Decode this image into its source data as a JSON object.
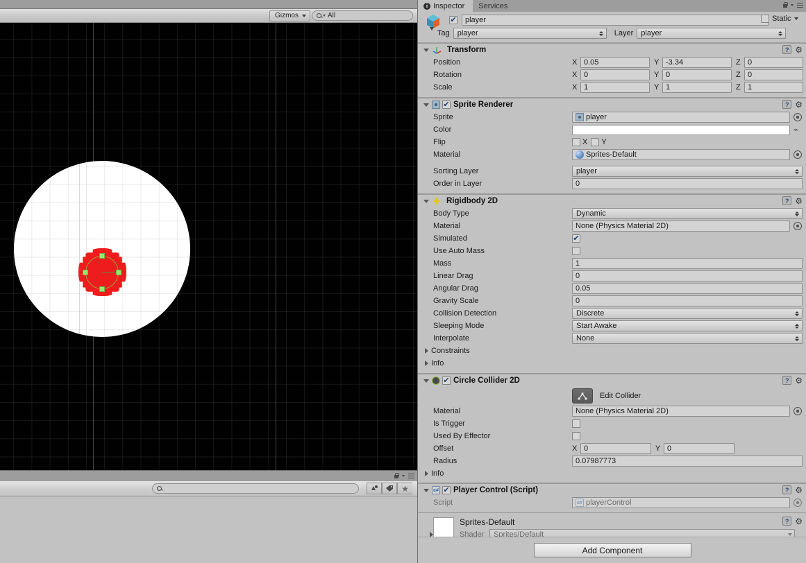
{
  "scene": {
    "toolbar": {
      "gizmos_label": "Gizmos",
      "search_value": "All"
    },
    "object": {
      "sprite_name": "player",
      "sprite_color": "#ee1c1c",
      "background": "#010101",
      "circle_color": "#ffffff"
    }
  },
  "project": {
    "search_placeholder": ""
  },
  "inspector": {
    "tabs": [
      {
        "label": "Inspector",
        "active": true,
        "icon": "info-icon"
      },
      {
        "label": "Services",
        "active": false
      }
    ],
    "gameobject": {
      "enabled": true,
      "name": "player",
      "static_label": "Static",
      "static_checked": false,
      "tag_label": "Tag",
      "tag_value": "player",
      "layer_label": "Layer",
      "layer_value": "player"
    },
    "components": [
      {
        "title": "Transform",
        "icon": "transform-axis-icon",
        "expanded": true,
        "has_enable_checkbox": false,
        "rows": [
          {
            "label": "Position",
            "type": "vector3",
            "x": "0.05",
            "y": "-3.34",
            "z": "0"
          },
          {
            "label": "Rotation",
            "type": "vector3",
            "x": "0",
            "y": "0",
            "z": "0"
          },
          {
            "label": "Scale",
            "type": "vector3",
            "x": "1",
            "y": "1",
            "z": "1"
          }
        ]
      },
      {
        "title": "Sprite Renderer",
        "icon": "sprite-renderer-icon",
        "expanded": true,
        "has_enable_checkbox": true,
        "enabled": true,
        "rows": [
          {
            "label": "Sprite",
            "type": "object",
            "value": "player",
            "icon": "sprite-asset-icon"
          },
          {
            "label": "Color",
            "type": "color",
            "value": "#ffffff"
          },
          {
            "label": "Flip",
            "type": "flip",
            "x_label": "X",
            "y_label": "Y",
            "x_checked": false,
            "y_checked": false
          },
          {
            "label": "Material",
            "type": "object",
            "value": "Sprites-Default",
            "icon": "material-sphere-icon"
          },
          {
            "label": "Sorting Layer",
            "type": "dropdown",
            "value": "player"
          },
          {
            "label": "Order in Layer",
            "type": "text",
            "value": "0"
          }
        ]
      },
      {
        "title": "Rigidbody 2D",
        "icon": "rigidbody2d-icon",
        "expanded": true,
        "has_enable_checkbox": false,
        "rows": [
          {
            "label": "Body Type",
            "type": "dropdown",
            "value": "Dynamic"
          },
          {
            "label": "Material",
            "type": "object",
            "value": "None (Physics Material 2D)"
          },
          {
            "label": "Simulated",
            "type": "checkbox",
            "checked": true
          },
          {
            "label": "Use Auto Mass",
            "type": "checkbox",
            "checked": false
          },
          {
            "label": "Mass",
            "type": "text",
            "value": "1"
          },
          {
            "label": "Linear Drag",
            "type": "text",
            "value": "0"
          },
          {
            "label": "Angular Drag",
            "type": "text",
            "value": "0.05"
          },
          {
            "label": "Gravity Scale",
            "type": "text",
            "value": "0"
          },
          {
            "label": "Collision Detection",
            "type": "dropdown",
            "value": "Discrete"
          },
          {
            "label": "Sleeping Mode",
            "type": "dropdown",
            "value": "Start Awake"
          },
          {
            "label": "Interpolate",
            "type": "dropdown",
            "value": "None"
          },
          {
            "label": "Constraints",
            "type": "foldout"
          },
          {
            "label": "Info",
            "type": "foldout"
          }
        ]
      },
      {
        "title": "Circle Collider 2D",
        "icon": "circle-collider-icon",
        "expanded": true,
        "has_enable_checkbox": true,
        "enabled": true,
        "edit_collider_label": "Edit Collider",
        "rows": [
          {
            "label": "Material",
            "type": "object",
            "value": "None (Physics Material 2D)"
          },
          {
            "label": "Is Trigger",
            "type": "checkbox",
            "checked": false
          },
          {
            "label": "Used By Effector",
            "type": "checkbox",
            "checked": false
          },
          {
            "label": "Offset",
            "type": "vector2",
            "x": "0",
            "y": "0"
          },
          {
            "label": "Radius",
            "type": "text",
            "value": "0.07987773"
          },
          {
            "label": "Info",
            "type": "foldout"
          }
        ]
      },
      {
        "title": "Player Control (Script)",
        "icon": "cs-script-icon",
        "expanded": true,
        "has_enable_checkbox": true,
        "enabled": true,
        "rows": [
          {
            "label": "Script",
            "type": "object",
            "value": "playerControl",
            "dim": true,
            "icon": "cs-script-icon"
          }
        ]
      }
    ],
    "material_preview": {
      "name": "Sprites-Default",
      "shader_label": "Shader",
      "shader_value": "Sprites/Default"
    },
    "add_component_label": "Add Component"
  }
}
